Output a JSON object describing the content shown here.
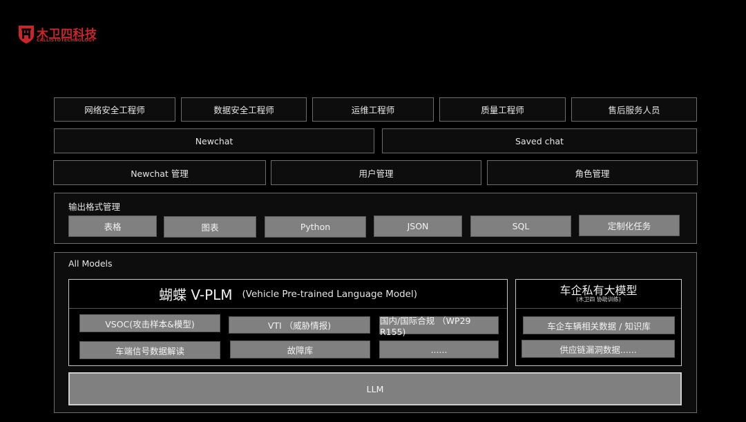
{
  "logo": {
    "name_cn": "木卫四科技",
    "name_en": "CALLISTOTECHNOLOGY",
    "brand_color": "#c8262c",
    "icon": "shield-logo-icon"
  },
  "roles": [
    {
      "label": "网络安全工程师"
    },
    {
      "label": "数据安全工程师"
    },
    {
      "label": "运维工程师"
    },
    {
      "label": "质量工程师"
    },
    {
      "label": "售后服务人员"
    }
  ],
  "chats": {
    "newchat": "Newchat",
    "saved_chat": "Saved chat"
  },
  "management": [
    {
      "label": "Newchat 管理"
    },
    {
      "label": "用户管理"
    },
    {
      "label": "角色管理"
    }
  ],
  "output_formats": {
    "title": "输出格式管理",
    "items": [
      {
        "label": "表格"
      },
      {
        "label": "图表"
      },
      {
        "label": "Python"
      },
      {
        "label": "JSON"
      },
      {
        "label": "SQL"
      },
      {
        "label": "定制化任务"
      }
    ]
  },
  "all_models": {
    "title": "All Models",
    "vplm": {
      "title": "蝴蝶 V-PLM",
      "subtitle": "(Vehicle Pre-trained Language Model)",
      "items": [
        {
          "label": "VSOC(攻击样本&模型)"
        },
        {
          "label": "VTI （威胁情报)"
        },
        {
          "label": "国内/国际合规 （WP29 R155)"
        },
        {
          "label": "车端信号数据解读"
        },
        {
          "label": "故障库"
        },
        {
          "label": "......"
        }
      ]
    },
    "private_model": {
      "title": "车企私有大模型",
      "subtitle": "(木卫四 协助训练)",
      "items": [
        {
          "label": "车企车辆相关数据 / 知识库"
        },
        {
          "label": "供应链漏洞数据......"
        }
      ]
    },
    "llm": "LLM"
  },
  "colors": {
    "background": "#000000",
    "panel": "#0d0d0d",
    "border": "#6e6e6e",
    "gray_button": "#808080"
  }
}
